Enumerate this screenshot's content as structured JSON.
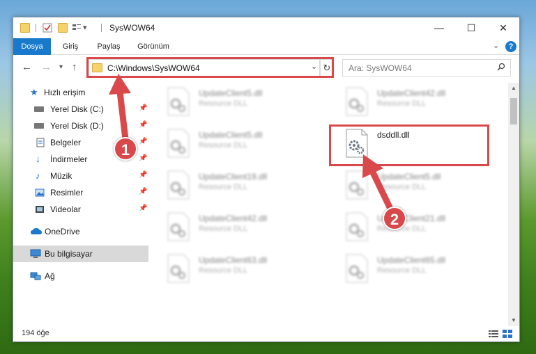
{
  "window": {
    "title": "SysWOW64"
  },
  "ribbon": {
    "tabs": [
      {
        "label": "Dosya",
        "active": true
      },
      {
        "label": "Giriş",
        "active": false
      },
      {
        "label": "Paylaş",
        "active": false
      },
      {
        "label": "Görünüm",
        "active": false
      }
    ],
    "help_label": "?"
  },
  "address": {
    "path": "C:\\Windows\\SysWOW64",
    "search_placeholder": "Ara: SysWOW64"
  },
  "nav": {
    "items": [
      {
        "label": "Hızlı erişim",
        "icon": "star-icon"
      },
      {
        "label": "Yerel Disk (C:)",
        "icon": "drive-icon"
      },
      {
        "label": "Yerel Disk (D:)",
        "icon": "drive-icon"
      },
      {
        "label": "Belgeler",
        "icon": "document-icon"
      },
      {
        "label": "İndirmeler",
        "icon": "download-icon"
      },
      {
        "label": "Müzik",
        "icon": "music-icon"
      },
      {
        "label": "Resimler",
        "icon": "pictures-icon"
      },
      {
        "label": "Videolar",
        "icon": "video-icon"
      },
      {
        "label": "OneDrive",
        "icon": "cloud-icon"
      },
      {
        "label": "Bu bilgisayar",
        "icon": "computer-icon",
        "selected": true
      },
      {
        "label": "Ağ",
        "icon": "network-icon"
      }
    ]
  },
  "files": [
    {
      "name": "UpdateClient5.dll",
      "type": "Resource DLL"
    },
    {
      "name": "UpdateClient42.dll",
      "type": "Resource DLL"
    },
    {
      "name": "UpdateClient5.dll",
      "type": "Resource DLL"
    },
    {
      "name": "dsddll.dll",
      "type": ""
    },
    {
      "name": "UpdateClient19.dll",
      "type": "Resource DLL"
    },
    {
      "name": "UpdateClient5.dll",
      "type": "Resource DLL"
    },
    {
      "name": "UpdateClient42.dll",
      "type": "Resource DLL"
    },
    {
      "name": "UpdateClient21.dll",
      "type": "Resource DLL"
    },
    {
      "name": "UpdateClient63.dll",
      "type": "Resource DLL"
    },
    {
      "name": "UpdateClient65.dll",
      "type": "Resource DLL"
    }
  ],
  "status": {
    "item_count": "194 öğe"
  },
  "annotations": {
    "step1": "1",
    "step2": "2"
  },
  "colors": {
    "accent": "#1979ca",
    "highlight": "#d9494b"
  }
}
